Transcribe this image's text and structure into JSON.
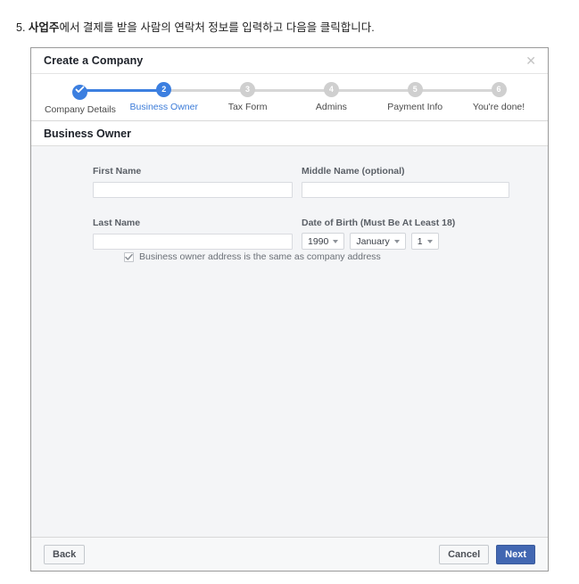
{
  "instruction": {
    "number": "5.",
    "bold_part": "사업주",
    "rest": "에서 결제를 받을 사람의 연락처 정보를 입력하고 다음을 클릭합니다."
  },
  "dialog": {
    "title": "Create a Company",
    "close_icon": "close-icon",
    "section_title": "Business Owner",
    "stepper": [
      {
        "number": "1",
        "label": "Company Details",
        "state": "done"
      },
      {
        "number": "2",
        "label": "Business Owner",
        "state": "active"
      },
      {
        "number": "3",
        "label": "Tax Form",
        "state": "inactive"
      },
      {
        "number": "4",
        "label": "Admins",
        "state": "inactive"
      },
      {
        "number": "5",
        "label": "Payment Info",
        "state": "inactive"
      },
      {
        "number": "6",
        "label": "You're done!",
        "state": "inactive"
      }
    ],
    "form": {
      "first_name": {
        "label": "First Name",
        "value": "",
        "placeholder": ""
      },
      "middle_name": {
        "label": "Middle Name (optional)",
        "value": "",
        "placeholder": ""
      },
      "last_name": {
        "label": "Last Name",
        "value": "",
        "placeholder": ""
      },
      "dob": {
        "label": "Date of Birth (Must Be At Least 18)",
        "year": "1990",
        "month": "January",
        "day": "1"
      },
      "same_address": {
        "label": "Business owner address is the same as company address",
        "checked": true
      }
    },
    "footer": {
      "back": "Back",
      "cancel": "Cancel",
      "next": "Next"
    },
    "colors": {
      "accent_blue": "#3c7fe0",
      "primary_button": "#4267b2",
      "inactive_gray": "#cfcfcf",
      "body_bg": "#f4f5f7"
    }
  }
}
